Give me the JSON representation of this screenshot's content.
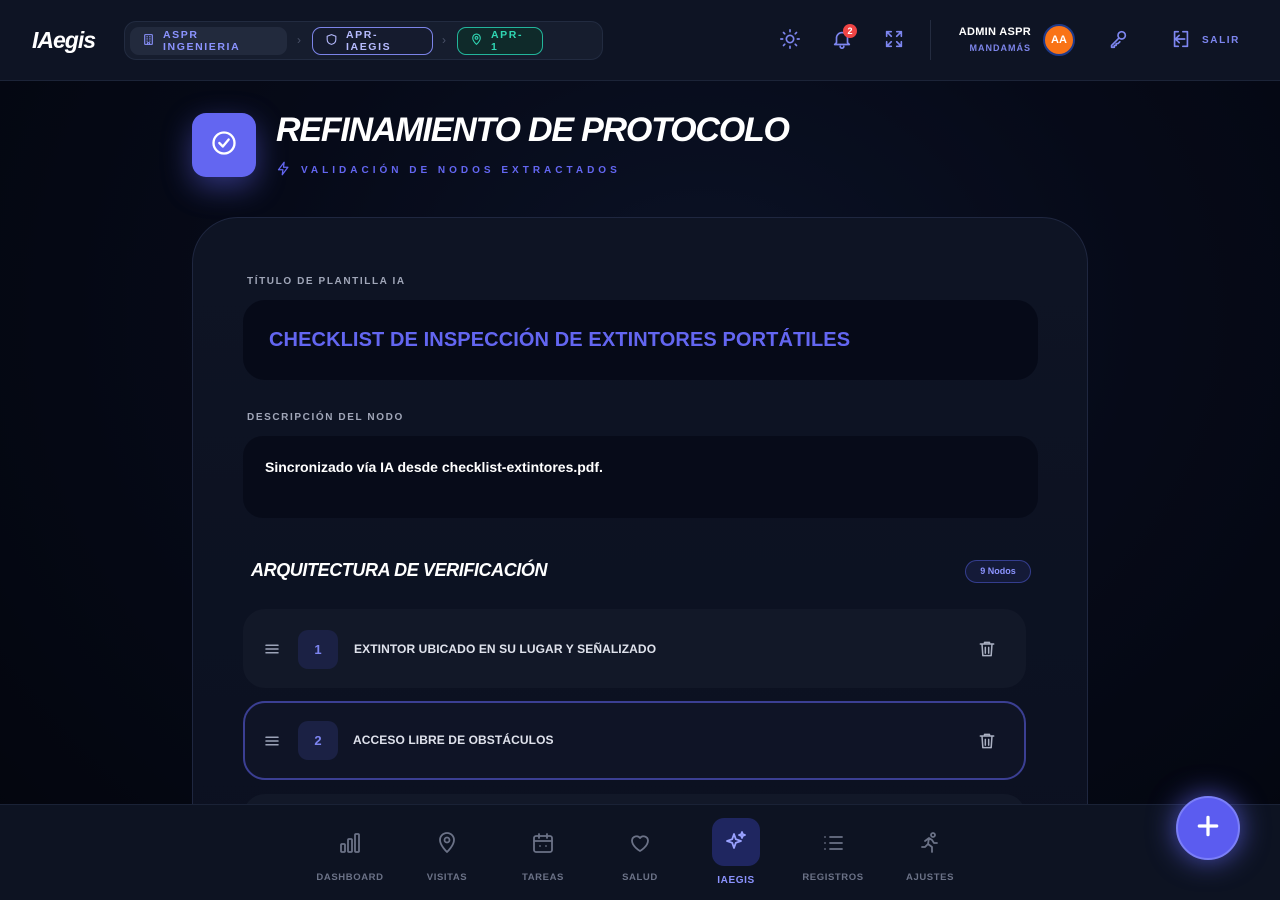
{
  "app": {
    "logo": "IAegis"
  },
  "breadcrumb": {
    "items": [
      {
        "label": "ASPR INGENIERIA",
        "icon": "building-icon"
      },
      {
        "label": "APR-IAEGIS",
        "icon": "shield-icon"
      },
      {
        "label": "APR-1",
        "icon": "map-pin-icon"
      }
    ]
  },
  "topbar": {
    "notification_count": "2",
    "user_name": "ADMIN ASPR",
    "user_role": "MANDAMÁS",
    "avatar_initials": "AA",
    "logout_label": "SALIR"
  },
  "header": {
    "title": "REFINAMIENTO DE PROTOCOLO",
    "subtitle": "VALIDACIÓN DE NODOS EXTRACTADOS"
  },
  "form": {
    "template_title_label": "TÍTULO DE PLANTILLA IA",
    "template_title_value": "CHECKLIST DE INSPECCIÓN DE EXTINTORES PORTÁTILES",
    "description_label": "DESCRIPCIÓN DEL NODO",
    "description_value": "Sincronizado vía IA desde checklist-extintores.pdf."
  },
  "architecture": {
    "title": "ARQUITECTURA DE VERIFICACIÓN",
    "node_count_label": "9 Nodos",
    "nodes": [
      {
        "number": "1",
        "label": "EXTINTOR UBICADO EN SU LUGAR Y SEÑALIZADO"
      },
      {
        "number": "2",
        "label": "ACCESO LIBRE DE OBSTÁCULOS"
      }
    ]
  },
  "bottom_nav": {
    "items": [
      {
        "label": "DASHBOARD",
        "icon": "bar-chart-icon"
      },
      {
        "label": "VISITAS",
        "icon": "map-pin-icon"
      },
      {
        "label": "TAREAS",
        "icon": "calendar-icon"
      },
      {
        "label": "SALUD",
        "icon": "heart-icon"
      },
      {
        "label": "IAEGIS",
        "icon": "sparkles-icon"
      },
      {
        "label": "REGISTROS",
        "icon": "list-icon"
      },
      {
        "label": "AJUSTES",
        "icon": "running-person-icon"
      }
    ],
    "active": "IAEGIS"
  },
  "colors": {
    "accent": "#6366f1",
    "teal": "#30d7b3",
    "badge_red": "#ef4444",
    "avatar_orange": "#f97316",
    "background": "#050814"
  }
}
